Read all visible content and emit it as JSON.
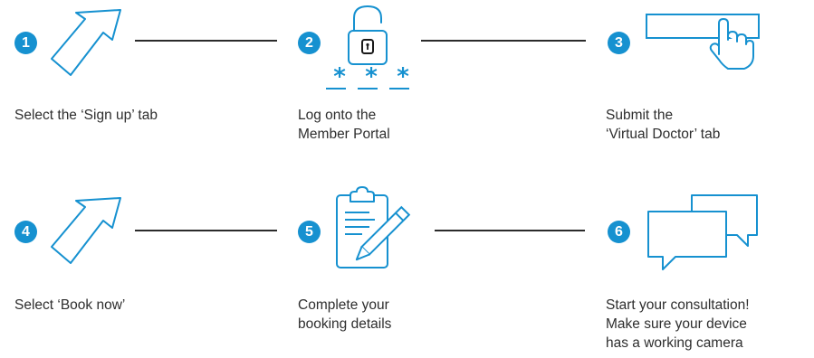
{
  "steps": [
    {
      "number": "1",
      "icon": "arrow-cursor-icon",
      "caption": [
        "Select the ‘Sign up’ tab"
      ]
    },
    {
      "number": "2",
      "icon": "padlock-password-icon",
      "caption": [
        "Log onto the",
        "Member Portal"
      ]
    },
    {
      "number": "3",
      "icon": "hand-tap-button-icon",
      "caption": [
        "Submit the",
        "‘Virtual Doctor’ tab"
      ]
    },
    {
      "number": "4",
      "icon": "arrow-cursor-icon",
      "caption": [
        "Select ‘Book now’"
      ]
    },
    {
      "number": "5",
      "icon": "clipboard-pencil-icon",
      "caption": [
        "Complete your",
        "booking details"
      ]
    },
    {
      "number": "6",
      "icon": "chat-bubbles-icon",
      "caption": [
        "Start your consultation!",
        "Make sure your device",
        "has a working camera"
      ]
    }
  ],
  "password_mask": [
    "*",
    "*",
    "*"
  ],
  "colors": {
    "accent": "#1691d0",
    "connector": "#2b2b2b",
    "text": "#2e2e2e"
  }
}
